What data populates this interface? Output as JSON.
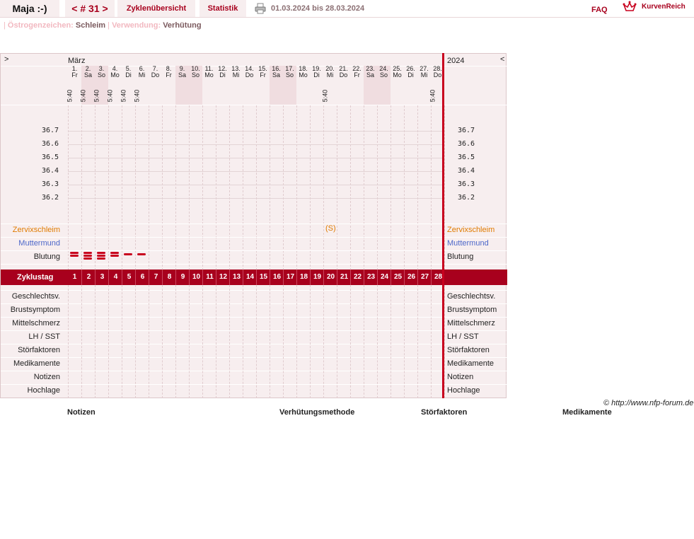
{
  "header": {
    "user": "Maja :-)",
    "cycle_nav": "< # 31 >",
    "tabs": [
      "Zyklenübersicht",
      "Statistik"
    ],
    "date_range": "01.03.2024 bis 28.03.2024",
    "faq": "FAQ",
    "brand": "KurvenReich"
  },
  "subheader": {
    "sign_label": "Östrogenzeichen:",
    "sign_value": "Schleim",
    "use_label": "Verwendung:",
    "use_value": "Verhütung"
  },
  "chart": {
    "nav_prev": ">",
    "nav_next": "<",
    "month": "März",
    "year": "2024",
    "days": [
      {
        "n": "1.",
        "w": "Fr",
        "t": "5:40"
      },
      {
        "n": "2.",
        "w": "Sa",
        "t": "5:40"
      },
      {
        "n": "3.",
        "w": "So",
        "t": "5:40"
      },
      {
        "n": "4.",
        "w": "Mo",
        "t": "5:40"
      },
      {
        "n": "5.",
        "w": "Di",
        "t": "5:40"
      },
      {
        "n": "6.",
        "w": "Mi",
        "t": "5:40"
      },
      {
        "n": "7.",
        "w": "Do",
        "t": ""
      },
      {
        "n": "8.",
        "w": "Fr",
        "t": ""
      },
      {
        "n": "9.",
        "w": "Sa",
        "t": ""
      },
      {
        "n": "10.",
        "w": "So",
        "t": ""
      },
      {
        "n": "11.",
        "w": "Mo",
        "t": ""
      },
      {
        "n": "12.",
        "w": "Di",
        "t": ""
      },
      {
        "n": "13.",
        "w": "Mi",
        "t": ""
      },
      {
        "n": "14.",
        "w": "Do",
        "t": ""
      },
      {
        "n": "15.",
        "w": "Fr",
        "t": ""
      },
      {
        "n": "16.",
        "w": "Sa",
        "t": ""
      },
      {
        "n": "17.",
        "w": "So",
        "t": ""
      },
      {
        "n": "18.",
        "w": "Mo",
        "t": ""
      },
      {
        "n": "19.",
        "w": "Di",
        "t": ""
      },
      {
        "n": "20.",
        "w": "Mi",
        "t": "5:40"
      },
      {
        "n": "21.",
        "w": "Do",
        "t": ""
      },
      {
        "n": "22.",
        "w": "Fr",
        "t": ""
      },
      {
        "n": "23.",
        "w": "Sa",
        "t": ""
      },
      {
        "n": "24.",
        "w": "So",
        "t": ""
      },
      {
        "n": "25.",
        "w": "Mo",
        "t": ""
      },
      {
        "n": "26.",
        "w": "Di",
        "t": ""
      },
      {
        "n": "27.",
        "w": "Mi",
        "t": ""
      },
      {
        "n": "28.",
        "w": "Do",
        "t": "5:40"
      }
    ],
    "weekend_days": [
      2,
      3,
      9,
      10,
      16,
      17,
      23,
      24
    ],
    "temp_ticks": [
      "36.7",
      "36.6",
      "36.5",
      "36.4",
      "36.3",
      "36.2"
    ],
    "rows_top": [
      {
        "label": "Zervixschleim",
        "color": "#e07b00"
      },
      {
        "label": "Muttermund",
        "color": "#4d67c9"
      },
      {
        "label": "Blutung",
        "color": "#222222"
      }
    ],
    "cervix_marker_day": 20,
    "cervix_symbol": "S",
    "bleeding": [
      {
        "day": 1,
        "level": 2
      },
      {
        "day": 2,
        "level": 3
      },
      {
        "day": 3,
        "level": 3
      },
      {
        "day": 4,
        "level": 2
      },
      {
        "day": 5,
        "level": 1
      },
      {
        "day": 6,
        "level": 1
      }
    ],
    "cycle_day_label": "Zyklustag",
    "cycle_days": [
      "1",
      "2",
      "3",
      "4",
      "5",
      "6",
      "7",
      "8",
      "9",
      "10",
      "11",
      "12",
      "13",
      "14",
      "15",
      "16",
      "17",
      "18",
      "19",
      "20",
      "21",
      "22",
      "23",
      "24",
      "25",
      "26",
      "27",
      "28"
    ],
    "rows_bottom": [
      "Geschlechtsv.",
      "Brustsymptom",
      "Mittelschmerz",
      "LH / SST",
      "Störfaktoren",
      "Medikamente",
      "Notizen",
      "Hochlage"
    ],
    "colors": {
      "accent": "#a8001d",
      "cycle_bar": "#a8001d",
      "bleed": "#c8001e",
      "panel": "#f7eeef"
    }
  },
  "footer": {
    "copyright": "© http://www.nfp-forum.de",
    "headings": [
      "Notizen",
      "Verhütungsmethode",
      "Störfaktoren",
      "Medikamente"
    ]
  }
}
